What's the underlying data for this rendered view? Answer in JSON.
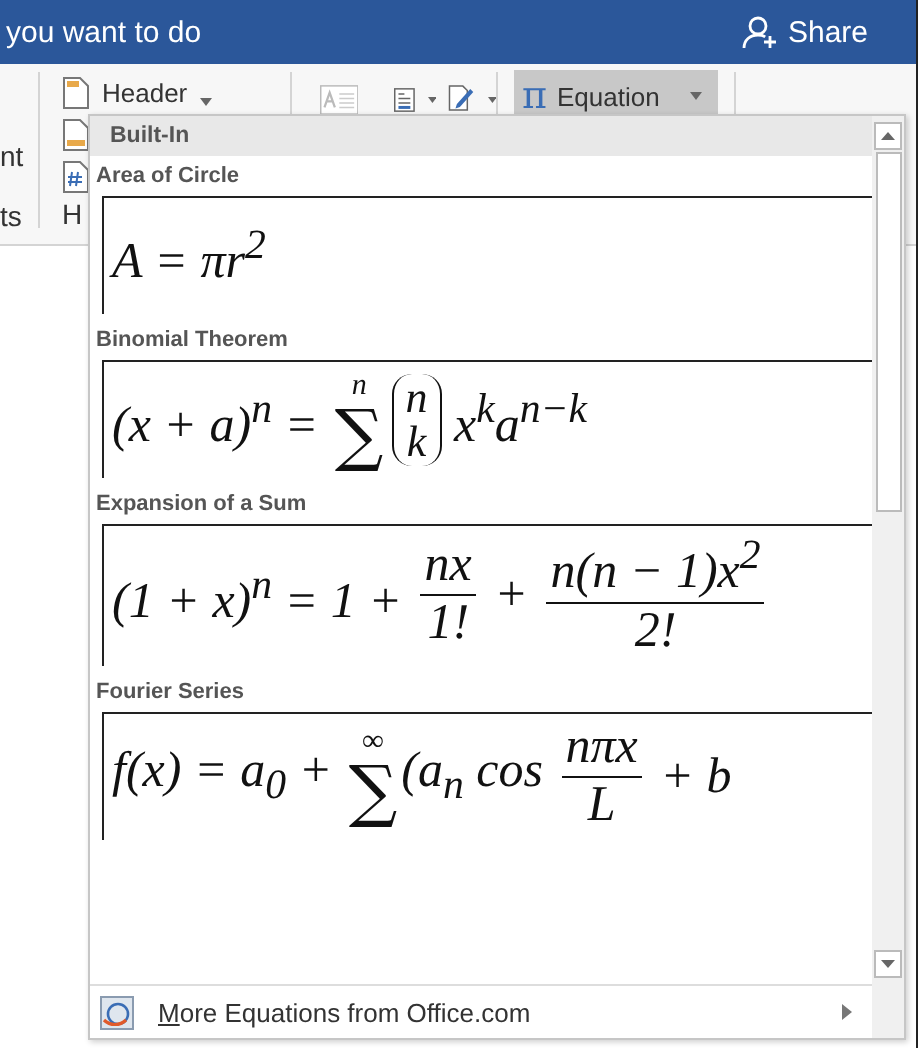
{
  "title_bar": {
    "text": "you want to do",
    "share": "Share"
  },
  "ribbon": {
    "left_fragments": [
      "nt",
      "ts"
    ],
    "group_fragment": "H",
    "header_button": {
      "label": "Header"
    },
    "equation_button": {
      "symbol": "π",
      "label": "Equation",
      "selected": true
    }
  },
  "gallery": {
    "section": "Built-In",
    "items": [
      {
        "title": "Area of Circle",
        "equation": [
          {
            "kind": "text",
            "text": "A = πr$^{2}$"
          }
        ]
      },
      {
        "title": "Binomial Theorem",
        "equation": [
          {
            "kind": "text",
            "text": "(x + a)$^{n}$ = "
          },
          {
            "kind": "sum",
            "symbol": "∑",
            "upper": "n"
          },
          {
            "kind": "binom",
            "top": "n",
            "bottom": "k"
          },
          {
            "kind": "text",
            "text": " x$^{k}$a$^{n−k}$"
          }
        ]
      },
      {
        "title": "Expansion of a Sum",
        "equation": [
          {
            "kind": "text",
            "text": "(1 + x)$^{n}$ = 1 + "
          },
          {
            "kind": "frac",
            "num": "nx",
            "den": "1!"
          },
          {
            "kind": "text",
            "text": " + "
          },
          {
            "kind": "frac",
            "num": "n(n − 1)x$^{2}$",
            "den": "2!"
          }
        ]
      },
      {
        "title": "Fourier Series",
        "equation": [
          {
            "kind": "text",
            "text": "f(x) = a$_{0}$ + "
          },
          {
            "kind": "sum",
            "symbol": "∑",
            "upper": "∞"
          },
          {
            "kind": "text",
            "text": "(a$_{n}$ cos "
          },
          {
            "kind": "frac",
            "num": "nπx",
            "den": "L"
          },
          {
            "kind": "text",
            "text": " + b"
          }
        ]
      }
    ],
    "footer": "More Equations from Office.com"
  }
}
